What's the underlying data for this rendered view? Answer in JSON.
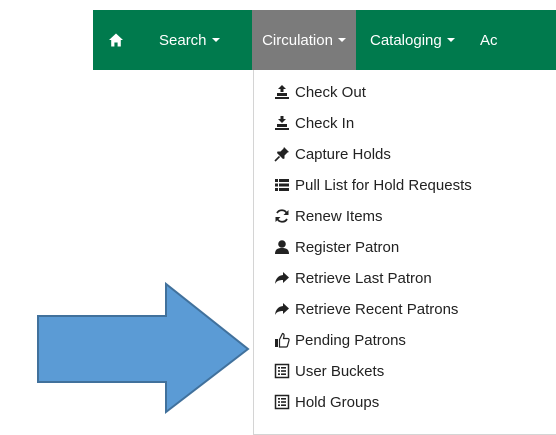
{
  "nav": {
    "home_icon": "home-icon",
    "items": [
      {
        "label": "Search"
      },
      {
        "label": "Circulation"
      },
      {
        "label": "Cataloging"
      },
      {
        "label": "Ac"
      }
    ]
  },
  "circulation_menu": {
    "items": [
      {
        "label": "Check Out",
        "icon": "check-out-icon"
      },
      {
        "label": "Check In",
        "icon": "check-in-icon"
      },
      {
        "label": "Capture Holds",
        "icon": "pushpin-icon"
      },
      {
        "label": "Pull List for Hold Requests",
        "icon": "list-icon"
      },
      {
        "label": "Renew Items",
        "icon": "refresh-icon"
      },
      {
        "label": "Register Patron",
        "icon": "user-icon"
      },
      {
        "label": "Retrieve Last Patron",
        "icon": "share-arrow-icon"
      },
      {
        "label": "Retrieve Recent Patrons",
        "icon": "share-arrow-icon"
      },
      {
        "label": "Pending Patrons",
        "icon": "thumbs-up-icon"
      },
      {
        "label": "User Buckets",
        "icon": "list-alt-icon"
      },
      {
        "label": "Hold Groups",
        "icon": "list-alt-icon"
      }
    ]
  },
  "colors": {
    "navbar": "#007a4d",
    "active_nav": "#7b7b7b",
    "arrow_fill": "#5b9bd5",
    "arrow_stroke": "#41719c"
  }
}
